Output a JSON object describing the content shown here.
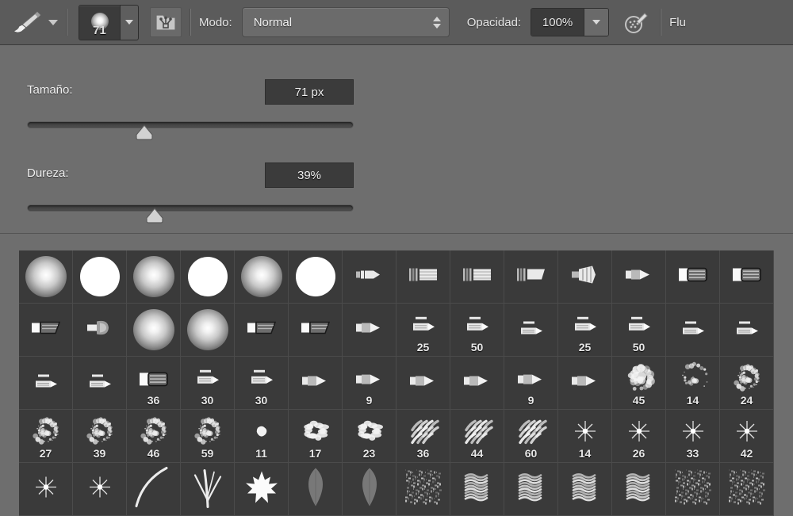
{
  "options_bar": {
    "tool_icon": "paintbrush-icon",
    "tool_preset_chevron": "chevron-down-icon",
    "brush_size_value": "71",
    "brush_preset_dropdown_icon": "chevron-down-icon",
    "brush_panel_icon": "brush-panel-folder-icon",
    "mode_label": "Modo:",
    "mode_value": "Normal",
    "mode_spinner_icon": "spinner-updown-icon",
    "opacity_label": "Opacidad:",
    "opacity_value": "100%",
    "opacity_dropdown_icon": "chevron-down-icon",
    "airbrush_icon": "airbrush-icon",
    "flow_label": "Flu"
  },
  "brush_settings": {
    "size": {
      "label": "Tamaño:",
      "value": "71 px",
      "slider_percent": 36
    },
    "hardness": {
      "label": "Dureza:",
      "value": "39%",
      "slider_percent": 39
    }
  },
  "brush_grid": {
    "columns": 14,
    "rows": [
      [
        {
          "tip": "soft-round",
          "label": ""
        },
        {
          "tip": "hard-round",
          "label": ""
        },
        {
          "tip": "soft-round",
          "label": ""
        },
        {
          "tip": "hard-round",
          "label": ""
        },
        {
          "tip": "soft-round",
          "label": ""
        },
        {
          "tip": "hard-round",
          "label": ""
        },
        {
          "tip": "flat-tip-small",
          "label": ""
        },
        {
          "tip": "bristle-block",
          "label": ""
        },
        {
          "tip": "bristle-block",
          "label": ""
        },
        {
          "tip": "bristle-angled",
          "label": ""
        },
        {
          "tip": "fan-spray",
          "label": ""
        },
        {
          "tip": "chisel-point",
          "label": ""
        },
        {
          "tip": "flat-block",
          "label": ""
        },
        {
          "tip": "flat-block",
          "label": ""
        }
      ],
      [
        {
          "tip": "angled-flat",
          "label": ""
        },
        {
          "tip": "spray-cone",
          "label": ""
        },
        {
          "tip": "soft-round",
          "label": ""
        },
        {
          "tip": "soft-round",
          "label": ""
        },
        {
          "tip": "angled-flat",
          "label": ""
        },
        {
          "tip": "angled-flat",
          "label": ""
        },
        {
          "tip": "chisel-point",
          "label": ""
        },
        {
          "tip": "marker-tip",
          "label": "25"
        },
        {
          "tip": "marker-tip",
          "label": "50"
        },
        {
          "tip": "marker-tip-low",
          "label": ""
        },
        {
          "tip": "marker-tip",
          "label": "25"
        },
        {
          "tip": "marker-tip",
          "label": "50"
        },
        {
          "tip": "marker-tip-low",
          "label": ""
        },
        {
          "tip": "marker-tip-low",
          "label": ""
        }
      ],
      [
        {
          "tip": "marker-tip-low",
          "label": ""
        },
        {
          "tip": "marker-tip-low",
          "label": ""
        },
        {
          "tip": "flat-block",
          "label": "36"
        },
        {
          "tip": "marker-tip",
          "label": "30"
        },
        {
          "tip": "marker-tip",
          "label": "30"
        },
        {
          "tip": "chisel-point",
          "label": ""
        },
        {
          "tip": "chisel-point",
          "label": "9"
        },
        {
          "tip": "chisel-point",
          "label": ""
        },
        {
          "tip": "chisel-point",
          "label": ""
        },
        {
          "tip": "chisel-point",
          "label": "9"
        },
        {
          "tip": "chisel-point",
          "label": ""
        },
        {
          "tip": "splat-dense",
          "label": "45"
        },
        {
          "tip": "splat-sparse",
          "label": "14"
        },
        {
          "tip": "splat-scatter",
          "label": "24"
        }
      ],
      [
        {
          "tip": "splat-scatter",
          "label": "27"
        },
        {
          "tip": "splat-scatter",
          "label": "39"
        },
        {
          "tip": "splat-scatter",
          "label": "46"
        },
        {
          "tip": "splat-scatter",
          "label": "59"
        },
        {
          "tip": "blob-tiny",
          "label": "11"
        },
        {
          "tip": "blob-chalk",
          "label": "17"
        },
        {
          "tip": "blob-chalk",
          "label": "23"
        },
        {
          "tip": "stroke-clump",
          "label": "36"
        },
        {
          "tip": "stroke-clump",
          "label": "44"
        },
        {
          "tip": "stroke-clump",
          "label": "60"
        },
        {
          "tip": "star-sparkle",
          "label": "14"
        },
        {
          "tip": "star-sparkle",
          "label": "26"
        },
        {
          "tip": "star-sparkle",
          "label": "33"
        },
        {
          "tip": "star-sparkle",
          "label": "42"
        }
      ],
      [
        {
          "tip": "star-sparkle",
          "label": ""
        },
        {
          "tip": "star-sparkle",
          "label": ""
        },
        {
          "tip": "grass-arc",
          "label": ""
        },
        {
          "tip": "grass-blade",
          "label": ""
        },
        {
          "tip": "maple-leaf",
          "label": ""
        },
        {
          "tip": "leaf-shape",
          "label": ""
        },
        {
          "tip": "leaf-shape",
          "label": ""
        },
        {
          "tip": "texture-noise",
          "label": ""
        },
        {
          "tip": "scribble-tex",
          "label": ""
        },
        {
          "tip": "scribble-tex",
          "label": ""
        },
        {
          "tip": "scribble-tex",
          "label": ""
        },
        {
          "tip": "scribble-tex",
          "label": ""
        },
        {
          "tip": "texture-noise",
          "label": ""
        },
        {
          "tip": "texture-noise",
          "label": ""
        }
      ]
    ]
  },
  "colors": {
    "panel_bg": "#6e6e6e",
    "bar_bg": "#5b5b5b",
    "grid_bg": "#3a3a3a",
    "field_bg": "#3b3b3b",
    "text": "#efefef"
  }
}
